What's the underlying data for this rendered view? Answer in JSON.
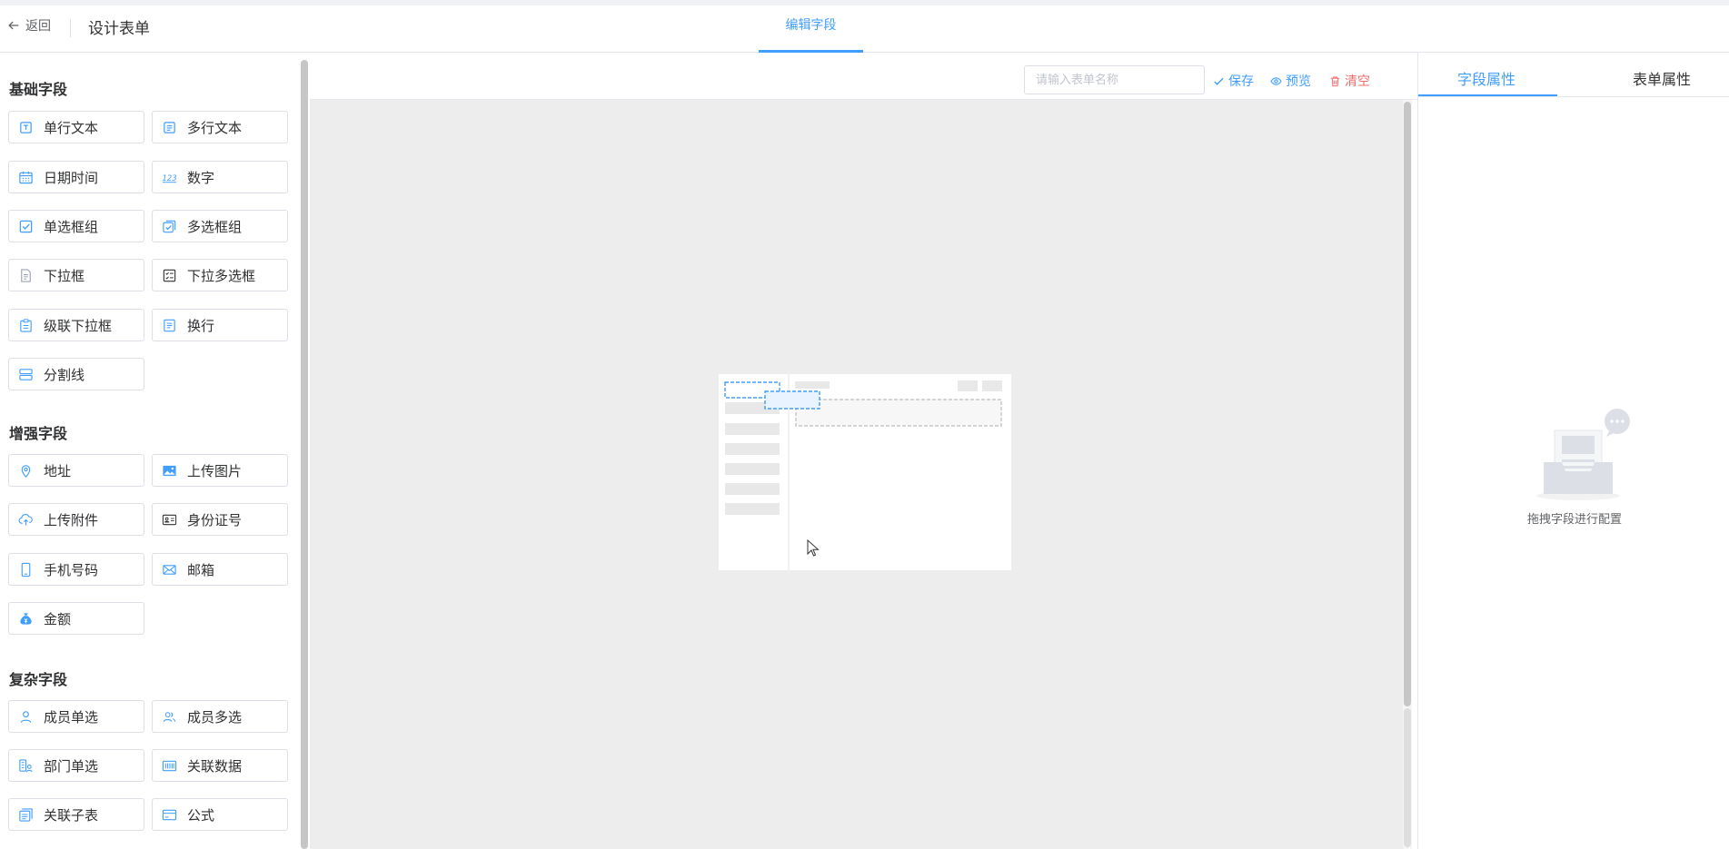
{
  "header": {
    "back_label": "返回",
    "title": "设计表单",
    "center_tab": "编辑字段"
  },
  "left_panel": {
    "groups": [
      {
        "title": "基础字段",
        "fields": [
          {
            "label": "单行文本",
            "icon": "single-line-text-icon"
          },
          {
            "label": "多行文本",
            "icon": "multi-line-text-icon"
          },
          {
            "label": "日期时间",
            "icon": "calendar-icon"
          },
          {
            "label": "数字",
            "icon": "number-123-icon"
          },
          {
            "label": "单选框组",
            "icon": "radio-check-icon"
          },
          {
            "label": "多选框组",
            "icon": "checkbox-group-icon"
          },
          {
            "label": "下拉框",
            "icon": "dropdown-doc-icon"
          },
          {
            "label": "下拉多选框",
            "icon": "dropdown-multi-icon"
          },
          {
            "label": "级联下拉框",
            "icon": "cascade-clipboard-icon"
          },
          {
            "label": "换行",
            "icon": "line-break-icon"
          },
          {
            "label": "分割线",
            "icon": "divider-icon"
          }
        ]
      },
      {
        "title": "增强字段",
        "fields": [
          {
            "label": "地址",
            "icon": "location-pin-icon"
          },
          {
            "label": "上传图片",
            "icon": "image-icon"
          },
          {
            "label": "上传附件",
            "icon": "cloud-upload-icon"
          },
          {
            "label": "身份证号",
            "icon": "id-card-icon"
          },
          {
            "label": "手机号码",
            "icon": "phone-icon"
          },
          {
            "label": "邮箱",
            "icon": "mail-icon"
          },
          {
            "label": "金额",
            "icon": "money-bag-icon"
          }
        ]
      },
      {
        "title": "复杂字段",
        "fields": [
          {
            "label": "成员单选",
            "icon": "user-icon"
          },
          {
            "label": "成员多选",
            "icon": "users-icon"
          },
          {
            "label": "部门单选",
            "icon": "department-icon"
          },
          {
            "label": "关联数据",
            "icon": "barcode-icon"
          },
          {
            "label": "关联子表",
            "icon": "sub-table-icon"
          },
          {
            "label": "公式",
            "icon": "formula-card-icon"
          }
        ]
      }
    ]
  },
  "toolbar": {
    "form_name_placeholder": "请输入表单名称",
    "save_label": "保存",
    "preview_label": "预览",
    "clear_label": "清空"
  },
  "right_panel": {
    "tabs": [
      "字段属性",
      "表单属性"
    ],
    "active_tab": 0,
    "empty_text": "拖拽字段进行配置"
  },
  "colors": {
    "accent": "#409eff",
    "danger": "#f56c6c",
    "canvas_bg": "#ededed"
  }
}
